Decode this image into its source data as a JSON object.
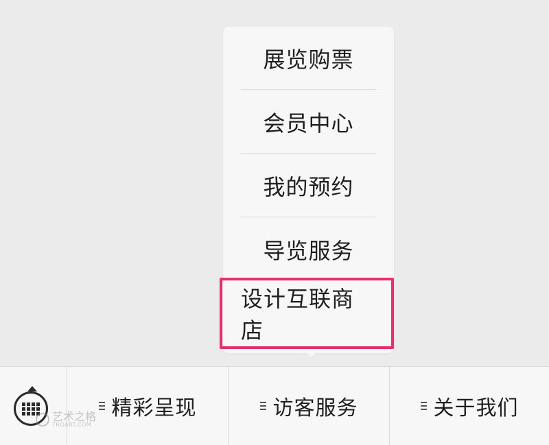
{
  "popup_menu": {
    "items": [
      {
        "label": "展览购票"
      },
      {
        "label": "会员中心"
      },
      {
        "label": "我的预约"
      },
      {
        "label": "导览服务"
      },
      {
        "label": "设计互联商店"
      }
    ],
    "highlighted_index": 4,
    "highlight_color": "#e3306e"
  },
  "bottom_menu": {
    "keyboard_icon": "keyboard-icon",
    "buttons": [
      {
        "label": "精彩呈现",
        "icon": "menu-lines-icon"
      },
      {
        "label": "访客服务",
        "icon": "menu-lines-icon"
      },
      {
        "label": "关于我们",
        "icon": "menu-lines-icon"
      }
    ]
  },
  "watermark": {
    "text_cn": "艺术之格",
    "text_en": "TROART.COM"
  }
}
